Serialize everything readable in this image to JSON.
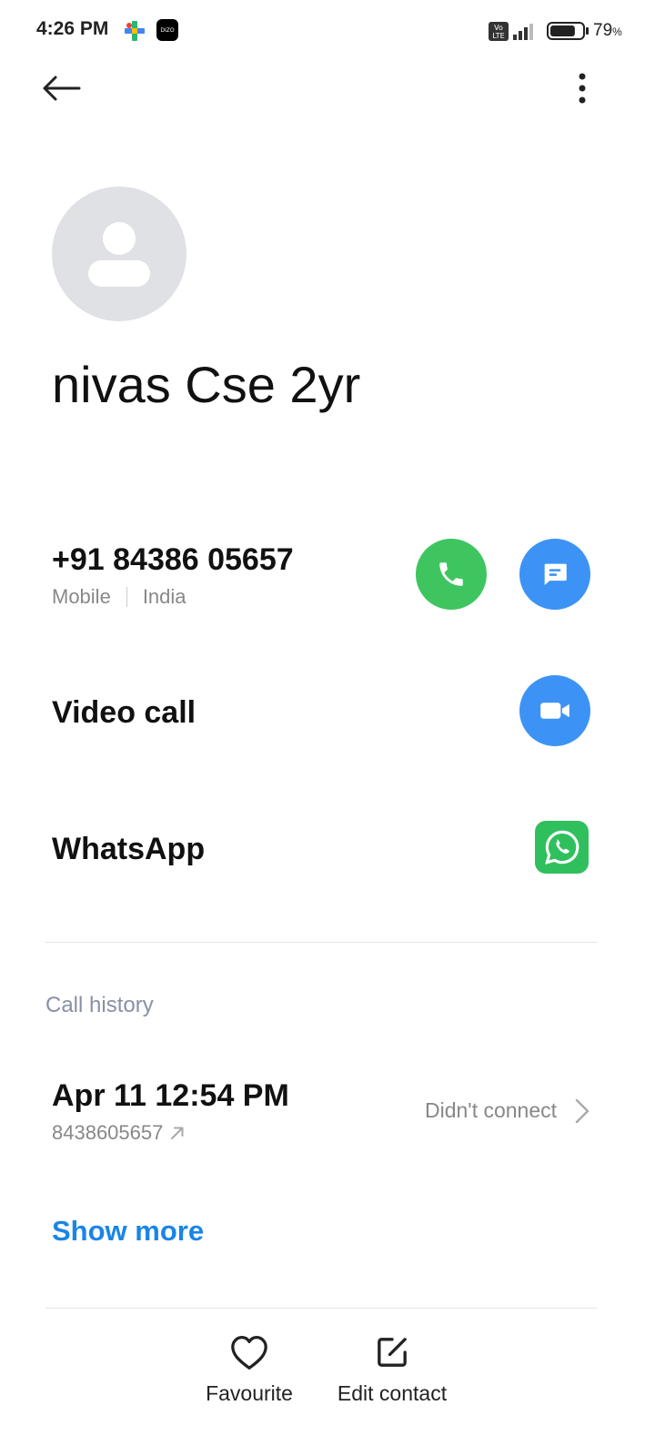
{
  "status_bar": {
    "time": "4:26 PM",
    "battery_percent": "79",
    "battery_unit": "%",
    "battery_level": 0.79,
    "icons": [
      "play-games-icon",
      "dizo-icon",
      "volte-icon",
      "signal-icon",
      "battery-icon"
    ],
    "dizo_text": "DIZO"
  },
  "contact": {
    "name": "nivas Cse 2yr",
    "phone": "+91 84386 05657",
    "phone_type": "Mobile",
    "phone_region": "India"
  },
  "actions": {
    "video_call_label": "Video call",
    "whatsapp_label": "WhatsApp"
  },
  "colors": {
    "call_green": "#3ec560",
    "message_blue": "#3d93f5",
    "whatsapp_green": "#2fc05d",
    "link_blue": "#1a85e5",
    "avatar_gray": "#dfe1e5"
  },
  "call_history": {
    "heading": "Call history",
    "entries": [
      {
        "time": "Apr 11 12:54 PM",
        "number": "8438605657",
        "direction": "outgoing",
        "status": "Didn't connect"
      }
    ],
    "show_more_label": "Show more"
  },
  "bottom_bar": {
    "favourite_label": "Favourite",
    "edit_label": "Edit contact"
  }
}
